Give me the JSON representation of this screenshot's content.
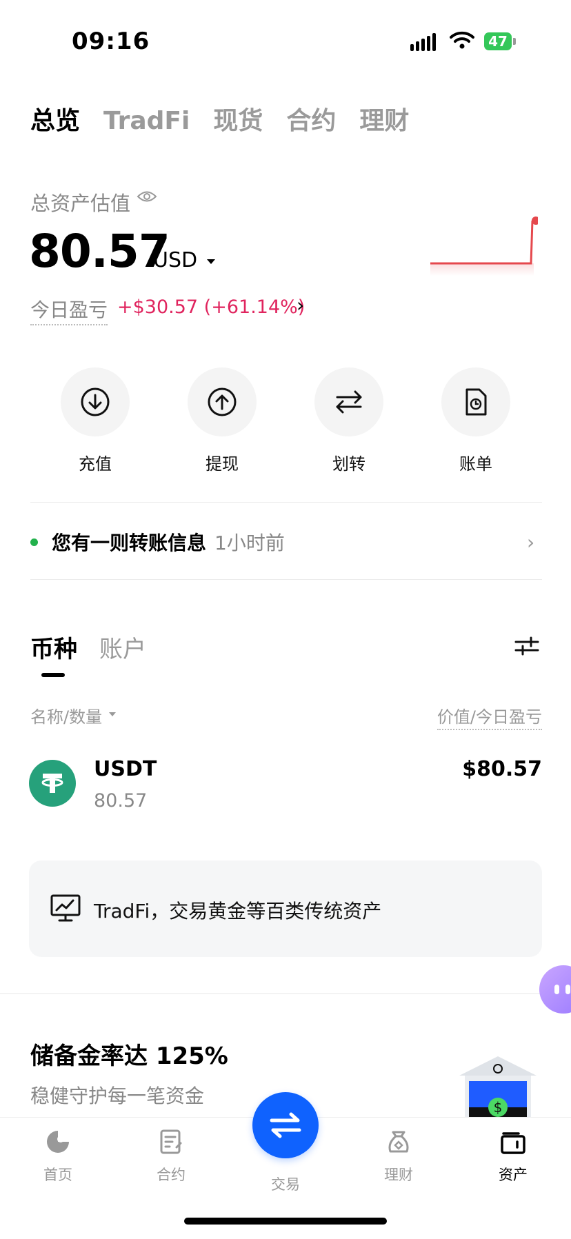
{
  "status_bar": {
    "time": "09:16",
    "battery": "47"
  },
  "top_tabs": [
    {
      "label": "总览",
      "active": true
    },
    {
      "label": "TradFi",
      "active": false
    },
    {
      "label": "现货",
      "active": false
    },
    {
      "label": "合约",
      "active": false
    },
    {
      "label": "理财",
      "active": false
    }
  ],
  "overview": {
    "total_label": "总资产估值",
    "amount": "80.57",
    "currency": "USD",
    "pnl_label": "今日盈亏",
    "pnl_value": "+$30.57 (+61.14%)",
    "trend_color": "#e5484d"
  },
  "actions": [
    {
      "label": "充值",
      "icon": "deposit-icon"
    },
    {
      "label": "提现",
      "icon": "withdraw-icon"
    },
    {
      "label": "划转",
      "icon": "transfer-icon"
    },
    {
      "label": "账单",
      "icon": "bill-icon"
    }
  ],
  "notice": {
    "text": "您有一则转账信息",
    "time": "1小时前"
  },
  "asset_tabs": [
    {
      "label": "币种",
      "active": true
    },
    {
      "label": "账户",
      "active": false
    }
  ],
  "columns": {
    "left": "名称/数量",
    "right": "价值/今日盈亏"
  },
  "coins": [
    {
      "name": "USDT",
      "qty": "80.57",
      "value": "$80.57"
    }
  ],
  "tradfi_card": {
    "text": "TradFi，交易黄金等百类传统资产"
  },
  "reserve": {
    "title": "储备金率达 125%",
    "subtitle": "稳健守护每一笔资金"
  },
  "bottom_nav": [
    {
      "label": "首页",
      "icon": "home-icon",
      "active": false
    },
    {
      "label": "合约",
      "icon": "contract-icon",
      "active": false
    },
    {
      "label": "交易",
      "icon": "trade-icon",
      "active": false
    },
    {
      "label": "理财",
      "icon": "earn-icon",
      "active": false
    },
    {
      "label": "资产",
      "icon": "wallet-icon",
      "active": true
    }
  ],
  "colors": {
    "accent": "#0f62fe",
    "pnl": "#e0245e",
    "online": "#22b14c",
    "usdt": "#26a17b"
  }
}
